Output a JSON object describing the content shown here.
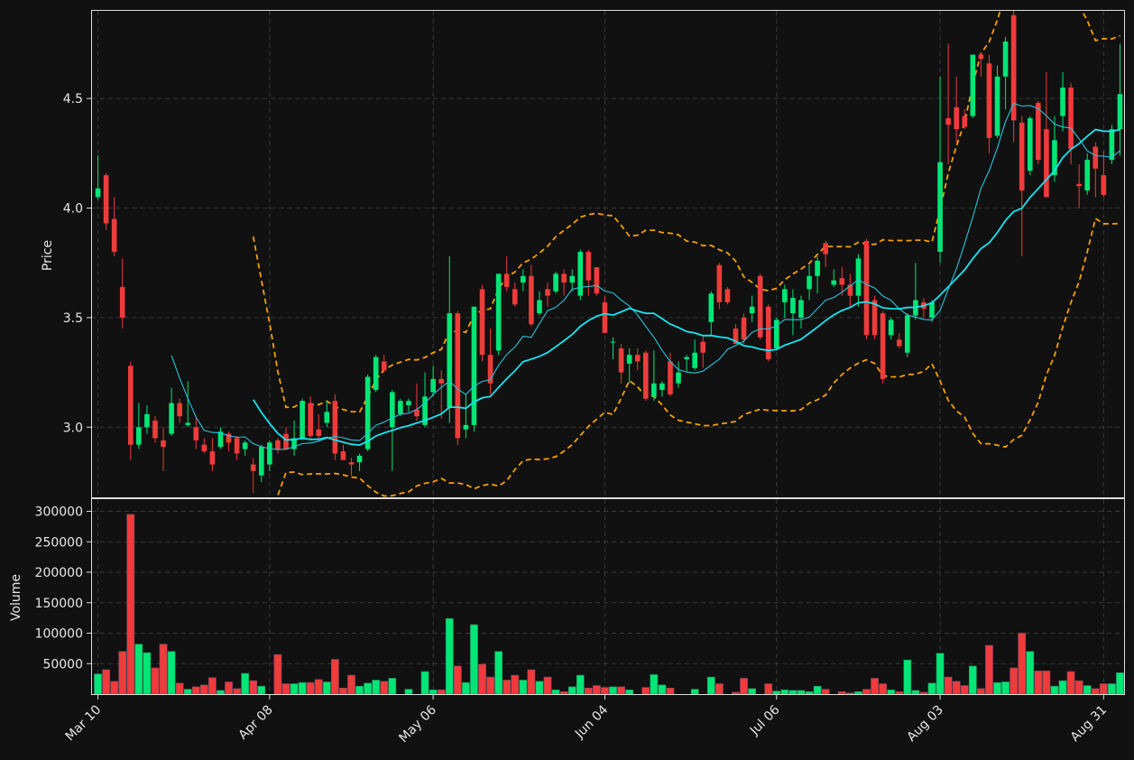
{
  "chart_data": {
    "type": "candlestick",
    "price_axis": {
      "label": "Price",
      "ylim": [
        2.68,
        4.9
      ],
      "ticks": [
        3.0,
        3.5,
        4.0,
        4.5
      ],
      "tick_labels": [
        "3.0",
        "3.5",
        "4.0",
        "4.5"
      ]
    },
    "volume_axis": {
      "label": "Volume",
      "ylim": [
        0,
        320000
      ],
      "ticks": [
        50000,
        100000,
        150000,
        200000,
        250000,
        300000
      ],
      "tick_labels": [
        "50000",
        "100000",
        "150000",
        "200000",
        "250000",
        "300000"
      ]
    },
    "date_ticks": [
      {
        "label": "Mar 10",
        "index": 0
      },
      {
        "label": "Apr 08",
        "index": 21
      },
      {
        "label": "May 06",
        "index": 41
      },
      {
        "label": "Jun 04",
        "index": 62
      },
      {
        "label": "Jul 06",
        "index": 83
      },
      {
        "label": "Aug 03",
        "index": 103
      },
      {
        "label": "Aug 31",
        "index": 123
      }
    ],
    "grid": true,
    "colors": {
      "up": "#00e676",
      "down": "#ef3b3b",
      "ma_fast": "#26c6da",
      "ma_slow": "#18e4f0",
      "bands": "#f5a000",
      "background": "#111111",
      "grid": "#3a3a3a",
      "frame": "#dddddd"
    },
    "overlays": [
      "moving-average-short",
      "moving-average-long",
      "upper-band",
      "lower-band"
    ],
    "ohlc": [
      [
        4.05,
        4.24,
        4.04,
        4.09,
        33000
      ],
      [
        4.15,
        4.16,
        3.9,
        3.93,
        40000
      ],
      [
        3.95,
        4.05,
        3.78,
        3.8,
        21000
      ],
      [
        3.64,
        3.77,
        3.45,
        3.5,
        70000
      ],
      [
        3.28,
        3.3,
        2.85,
        2.92,
        295000
      ],
      [
        2.92,
        3.11,
        2.9,
        3.0,
        82000
      ],
      [
        3.0,
        3.1,
        2.97,
        3.06,
        68000
      ],
      [
        3.03,
        3.05,
        2.93,
        2.95,
        43000
      ],
      [
        2.94,
        3.0,
        2.8,
        2.91,
        82000
      ],
      [
        2.97,
        3.18,
        2.96,
        3.11,
        70000
      ],
      [
        3.11,
        3.13,
        3.02,
        3.05,
        18000
      ],
      [
        3.01,
        3.21,
        3.0,
        3.02,
        8000
      ],
      [
        3.0,
        3.04,
        2.9,
        2.94,
        12000
      ],
      [
        2.92,
        2.95,
        2.88,
        2.89,
        15000
      ],
      [
        2.89,
        2.95,
        2.8,
        2.83,
        27000
      ],
      [
        2.91,
        3.0,
        2.9,
        2.98,
        6000
      ],
      [
        2.97,
        2.98,
        2.89,
        2.93,
        20000
      ],
      [
        2.95,
        2.96,
        2.85,
        2.88,
        9000
      ],
      [
        2.9,
        2.94,
        2.87,
        2.93,
        34000
      ],
      [
        2.83,
        2.86,
        2.7,
        2.8,
        22000
      ],
      [
        2.78,
        2.92,
        2.75,
        2.91,
        13000
      ],
      [
        2.83,
        2.94,
        2.8,
        2.93,
        0
      ],
      [
        2.94,
        2.95,
        2.88,
        2.9,
        65000
      ],
      [
        2.97,
        3.0,
        2.9,
        2.9,
        17000
      ],
      [
        2.9,
        3.03,
        2.87,
        2.95,
        17000
      ],
      [
        2.95,
        3.13,
        2.94,
        3.12,
        19000
      ],
      [
        3.11,
        3.14,
        2.95,
        2.96,
        19000
      ],
      [
        2.99,
        3.06,
        2.94,
        2.96,
        24000
      ],
      [
        3.02,
        3.12,
        3.0,
        3.07,
        20000
      ],
      [
        3.12,
        3.15,
        2.85,
        2.88,
        57000
      ],
      [
        2.89,
        2.92,
        2.85,
        2.85,
        10000
      ],
      [
        2.84,
        2.86,
        2.78,
        2.83,
        31000
      ],
      [
        2.84,
        2.88,
        2.8,
        2.87,
        13000
      ],
      [
        2.9,
        3.24,
        2.89,
        3.23,
        18000
      ],
      [
        3.17,
        3.33,
        3.16,
        3.32,
        23000
      ],
      [
        3.3,
        3.33,
        3.25,
        3.26,
        21000
      ],
      [
        3.0,
        3.17,
        2.8,
        3.16,
        26000
      ],
      [
        3.06,
        3.13,
        3.05,
        3.12,
        0
      ],
      [
        3.1,
        3.13,
        3.07,
        3.12,
        8000
      ],
      [
        3.08,
        3.2,
        3.03,
        3.05,
        0
      ],
      [
        3.01,
        3.25,
        3.0,
        3.14,
        37000
      ],
      [
        3.16,
        3.28,
        3.14,
        3.22,
        7000
      ],
      [
        3.22,
        3.26,
        3.04,
        3.2,
        7000
      ],
      [
        3.09,
        3.78,
        3.02,
        3.52,
        124000
      ],
      [
        3.52,
        3.53,
        2.92,
        2.95,
        46000
      ],
      [
        2.99,
        3.15,
        2.95,
        3.01,
        19000
      ],
      [
        3.01,
        3.55,
        2.98,
        3.55,
        114000
      ],
      [
        3.63,
        3.65,
        3.3,
        3.33,
        49000
      ],
      [
        3.33,
        3.45,
        3.15,
        3.2,
        28000
      ],
      [
        3.35,
        3.7,
        3.33,
        3.7,
        70000
      ],
      [
        3.7,
        3.78,
        3.62,
        3.64,
        23000
      ],
      [
        3.63,
        3.66,
        3.55,
        3.56,
        31000
      ],
      [
        3.66,
        3.72,
        3.62,
        3.69,
        23000
      ],
      [
        3.69,
        3.74,
        3.46,
        3.47,
        40000
      ],
      [
        3.52,
        3.62,
        3.51,
        3.58,
        21000
      ],
      [
        3.63,
        3.66,
        3.55,
        3.6,
        28000
      ],
      [
        3.62,
        3.71,
        3.61,
        3.7,
        7000
      ],
      [
        3.7,
        3.72,
        3.6,
        3.66,
        4000
      ],
      [
        3.66,
        3.72,
        3.62,
        3.69,
        12000
      ],
      [
        3.6,
        3.81,
        3.58,
        3.8,
        31000
      ],
      [
        3.8,
        3.81,
        3.6,
        3.67,
        10000
      ],
      [
        3.73,
        3.73,
        3.6,
        3.61,
        14000
      ],
      [
        3.57,
        3.6,
        3.43,
        3.43,
        11000
      ],
      [
        3.39,
        3.41,
        3.31,
        3.39,
        12000
      ],
      [
        3.36,
        3.38,
        3.2,
        3.25,
        12000
      ],
      [
        3.29,
        3.36,
        3.2,
        3.33,
        7000
      ],
      [
        3.33,
        3.36,
        3.26,
        3.3,
        0
      ],
      [
        3.34,
        3.35,
        3.12,
        3.13,
        11000
      ],
      [
        3.14,
        3.35,
        3.12,
        3.2,
        32000
      ],
      [
        3.17,
        3.21,
        3.14,
        3.2,
        15000
      ],
      [
        3.3,
        3.34,
        3.14,
        3.15,
        10000
      ],
      [
        3.2,
        3.3,
        3.18,
        3.25,
        0
      ],
      [
        3.31,
        3.33,
        3.25,
        3.32,
        0
      ],
      [
        3.27,
        3.4,
        3.26,
        3.34,
        8000
      ],
      [
        3.39,
        3.42,
        3.27,
        3.34,
        0
      ],
      [
        3.48,
        3.62,
        3.42,
        3.61,
        28000
      ],
      [
        3.74,
        3.75,
        3.54,
        3.57,
        17000
      ],
      [
        3.63,
        3.64,
        3.56,
        3.57,
        0
      ],
      [
        3.45,
        3.47,
        3.38,
        3.38,
        3000
      ],
      [
        3.5,
        3.52,
        3.38,
        3.4,
        26000
      ],
      [
        3.52,
        3.6,
        3.48,
        3.55,
        9000
      ],
      [
        3.69,
        3.7,
        3.4,
        3.41,
        0
      ],
      [
        3.55,
        3.56,
        3.3,
        3.31,
        17000
      ],
      [
        3.36,
        3.5,
        3.35,
        3.49,
        5000
      ],
      [
        3.57,
        3.65,
        3.5,
        3.63,
        7000
      ],
      [
        3.52,
        3.63,
        3.42,
        3.59,
        6000
      ],
      [
        3.5,
        3.6,
        3.45,
        3.58,
        6000
      ],
      [
        3.63,
        3.74,
        3.58,
        3.69,
        4000
      ],
      [
        3.69,
        3.78,
        3.61,
        3.76,
        13000
      ],
      [
        3.84,
        3.85,
        3.73,
        3.79,
        8000
      ],
      [
        3.65,
        3.72,
        3.64,
        3.67,
        0
      ],
      [
        3.68,
        3.73,
        3.6,
        3.65,
        4000
      ],
      [
        3.65,
        3.7,
        3.55,
        3.6,
        2000
      ],
      [
        3.6,
        3.79,
        3.55,
        3.77,
        4000
      ],
      [
        3.85,
        3.86,
        3.4,
        3.42,
        8000
      ],
      [
        3.58,
        3.6,
        3.4,
        3.42,
        26000
      ],
      [
        3.52,
        3.53,
        3.2,
        3.22,
        17000
      ],
      [
        3.42,
        3.5,
        3.4,
        3.49,
        7000
      ],
      [
        3.4,
        3.43,
        3.36,
        3.37,
        4000
      ],
      [
        3.34,
        3.52,
        3.32,
        3.51,
        56000
      ],
      [
        3.51,
        3.75,
        3.49,
        3.58,
        6000
      ],
      [
        3.57,
        3.59,
        3.5,
        3.54,
        3000
      ],
      [
        3.5,
        3.58,
        3.48,
        3.57,
        18000
      ],
      [
        3.8,
        4.6,
        3.75,
        4.21,
        67000
      ],
      [
        4.41,
        4.75,
        4.2,
        4.38,
        28000
      ],
      [
        4.46,
        4.6,
        4.3,
        4.36,
        21000
      ],
      [
        4.42,
        4.45,
        4.36,
        4.37,
        14000
      ],
      [
        4.42,
        4.7,
        4.41,
        4.7,
        46000
      ],
      [
        4.7,
        4.71,
        4.6,
        4.68,
        9000
      ],
      [
        4.66,
        4.7,
        4.25,
        4.32,
        80000
      ],
      [
        4.33,
        4.65,
        4.32,
        4.6,
        19000
      ],
      [
        4.6,
        4.78,
        4.45,
        4.76,
        20000
      ],
      [
        4.88,
        4.9,
        4.3,
        4.4,
        43000
      ],
      [
        4.39,
        4.42,
        3.78,
        4.08,
        100000
      ],
      [
        4.17,
        4.42,
        4.15,
        4.41,
        70000
      ],
      [
        4.48,
        4.49,
        4.2,
        4.22,
        38000
      ],
      [
        4.36,
        4.62,
        4.05,
        4.05,
        38000
      ],
      [
        4.15,
        4.42,
        4.12,
        4.31,
        13000
      ],
      [
        4.42,
        4.62,
        4.35,
        4.55,
        22000
      ],
      [
        4.55,
        4.57,
        4.2,
        4.27,
        37000
      ],
      [
        4.11,
        4.2,
        4.0,
        4.1,
        22000
      ],
      [
        4.08,
        4.25,
        4.06,
        4.22,
        14000
      ],
      [
        4.28,
        4.3,
        4.05,
        4.18,
        9000
      ],
      [
        4.15,
        4.26,
        4.05,
        4.06,
        17000
      ],
      [
        4.22,
        4.38,
        4.2,
        4.36,
        17000
      ],
      [
        4.36,
        4.75,
        4.24,
        4.52,
        35000
      ]
    ]
  }
}
